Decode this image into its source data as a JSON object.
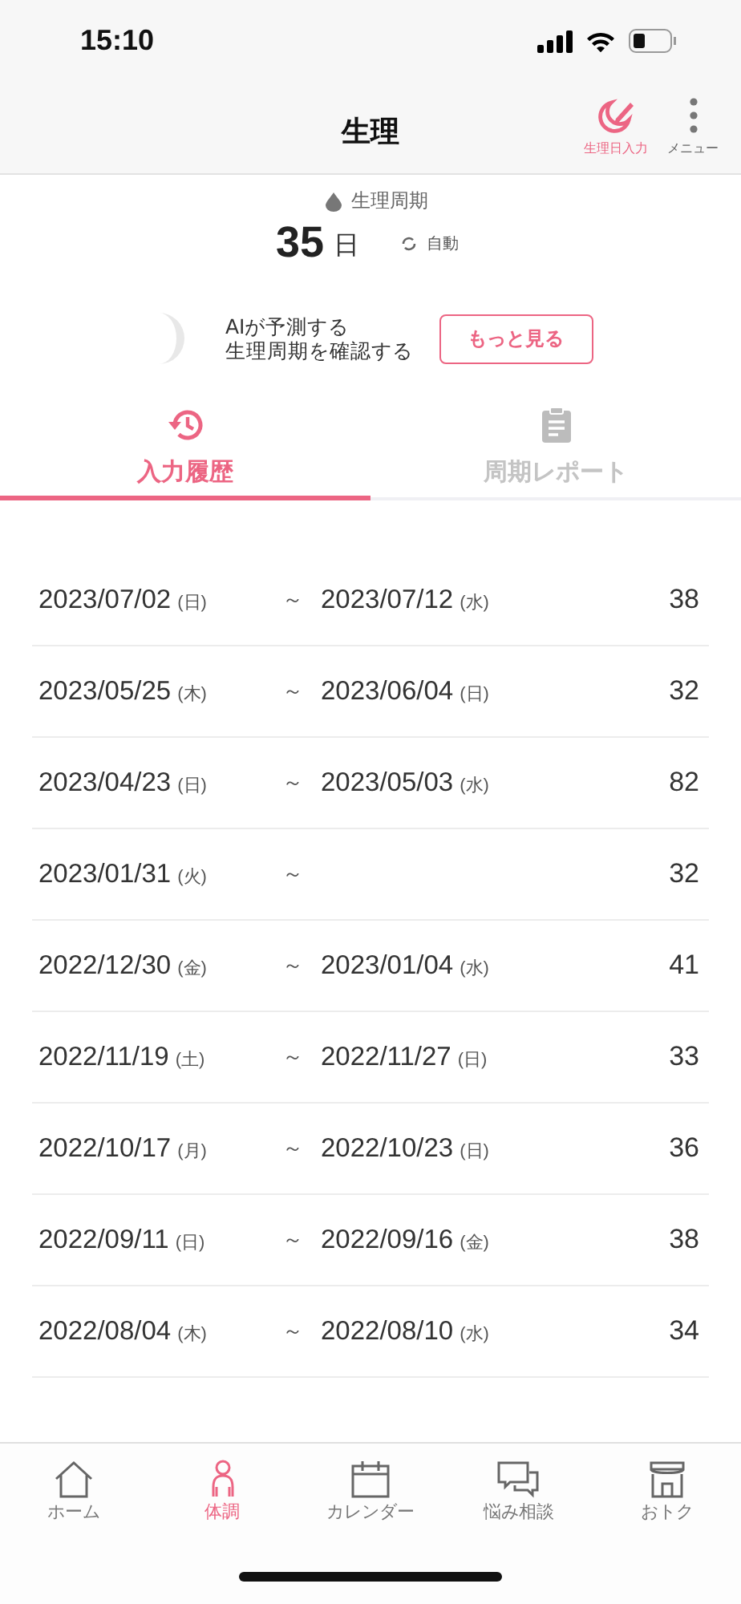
{
  "status_bar": {
    "time": "15:10"
  },
  "header": {
    "title": "生理",
    "actions": [
      {
        "label": "生理日入力",
        "kind": "period-input"
      },
      {
        "label": "メニュー",
        "kind": "menu"
      }
    ]
  },
  "cycle": {
    "label": "生理周期",
    "value": "35",
    "unit": "日",
    "mode": "自動"
  },
  "ai_banner": {
    "lines": [
      "AIが予測する",
      "生理周期を確認する"
    ],
    "button": "もっと見る"
  },
  "tabs": [
    {
      "label": "入力履歴",
      "kind": "history",
      "selected": true
    },
    {
      "label": "周期レポート",
      "kind": "report",
      "selected": false
    }
  ],
  "history": [
    {
      "start": "2023/07/02",
      "start_day": "(日)",
      "separator": "～",
      "end": "2023/07/12",
      "end_day": "(水)",
      "days": "38"
    },
    {
      "start": "2023/05/25",
      "start_day": "(木)",
      "separator": "～",
      "end": "2023/06/04",
      "end_day": "(日)",
      "days": "32"
    },
    {
      "start": "2023/04/23",
      "start_day": "(日)",
      "separator": "～",
      "end": "2023/05/03",
      "end_day": "(水)",
      "days": "82"
    },
    {
      "start": "2023/01/31",
      "start_day": "(火)",
      "separator": "～",
      "days": "32"
    },
    {
      "start": "2022/12/30",
      "start_day": "(金)",
      "separator": "～",
      "end": "2023/01/04",
      "end_day": "(水)",
      "days": "41"
    },
    {
      "start": "2022/11/19",
      "start_day": "(土)",
      "separator": "～",
      "end": "2022/11/27",
      "end_day": "(日)",
      "days": "33"
    },
    {
      "start": "2022/10/17",
      "start_day": "(月)",
      "separator": "～",
      "end": "2022/10/23",
      "end_day": "(日)",
      "days": "36"
    },
    {
      "start": "2022/09/11",
      "start_day": "(日)",
      "separator": "～",
      "end": "2022/09/16",
      "end_day": "(金)",
      "days": "38"
    },
    {
      "start": "2022/08/04",
      "start_day": "(木)",
      "separator": "～",
      "end": "2022/08/10",
      "end_day": "(水)",
      "days": "34"
    }
  ],
  "bottom_nav": [
    {
      "label": "ホーム",
      "kind": "home",
      "selected": false
    },
    {
      "label": "体調",
      "kind": "health",
      "selected": true
    },
    {
      "label": "カレンダー",
      "kind": "calendar",
      "selected": false
    },
    {
      "label": "悩み相談",
      "kind": "consult",
      "selected": false
    },
    {
      "label": "おトク",
      "kind": "deals",
      "selected": false
    }
  ]
}
